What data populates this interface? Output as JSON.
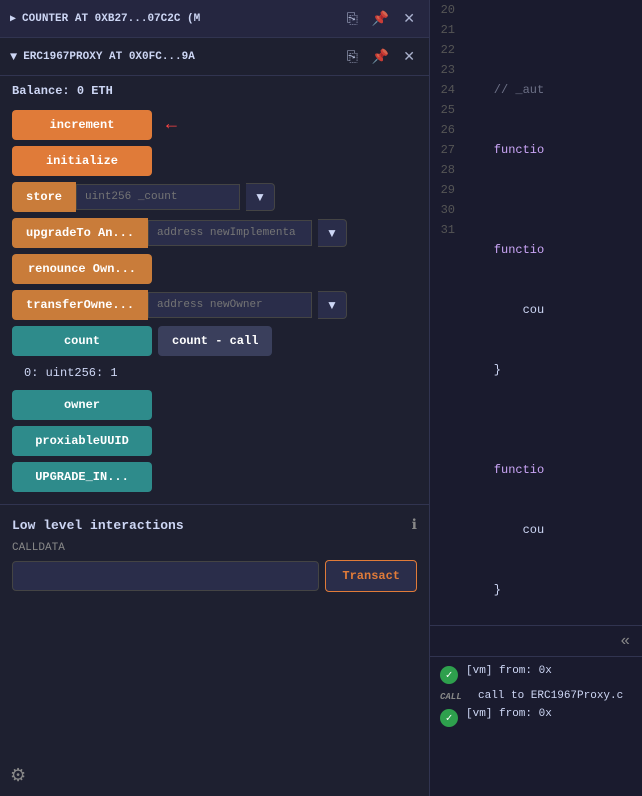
{
  "left_panel": {
    "contract1": {
      "title": "COUNTER AT 0XB27...07C2C (M",
      "copy_label": "copy",
      "pin_label": "pin",
      "close_label": "close"
    },
    "contract2": {
      "title": "ERC1967PROXY AT 0X0FC...9A",
      "copy_label": "copy",
      "pin_label": "pin",
      "close_label": "close"
    },
    "balance": {
      "label": "Balance:",
      "value": "0 ETH"
    },
    "buttons": [
      {
        "id": "increment",
        "label": "increment",
        "type": "orange",
        "has_arrow": true
      },
      {
        "id": "initialize",
        "label": "initialize",
        "type": "orange"
      },
      {
        "id": "store",
        "label": "store",
        "type": "orange-light",
        "input_placeholder": "uint256 _count",
        "has_dropdown": true
      },
      {
        "id": "upgradeToAn",
        "label": "upgradeTo An...",
        "type": "orange-light",
        "input_placeholder": "address newImplementa",
        "has_dropdown": true
      },
      {
        "id": "renounceOwn",
        "label": "renounce Own...",
        "type": "orange-light"
      },
      {
        "id": "transferOwne",
        "label": "transferOwne...",
        "type": "orange-light",
        "input_placeholder": "address newOwner",
        "has_dropdown": true
      },
      {
        "id": "count",
        "label": "count",
        "type": "teal",
        "call_label": "count - call"
      },
      {
        "id": "owner",
        "label": "owner",
        "type": "teal"
      },
      {
        "id": "proxiableUUID",
        "label": "proxiableUUID",
        "type": "teal"
      },
      {
        "id": "UPGRADE_IN",
        "label": "UPGRADE_IN...",
        "type": "teal"
      }
    ],
    "count_result": {
      "label": "0: uint256: 1"
    },
    "low_level": {
      "title": "Low level interactions",
      "calldata_label": "CALLDATA",
      "transact_label": "Transact"
    }
  },
  "right_panel": {
    "line_numbers": [
      20,
      21,
      22,
      23,
      24,
      25,
      26,
      27,
      28,
      29,
      30,
      31
    ],
    "code_lines": [
      "",
      "    // _aut",
      "    functio",
      "",
      "    functio",
      "        cou",
      "    }",
      "",
      "    functio",
      "        cou",
      "    }",
      "}"
    ]
  },
  "terminal": {
    "entries": [
      {
        "type": "success",
        "text": "[vm] from: 0x"
      },
      {
        "type": "call",
        "icon_label": "CALL",
        "text": "call to ERC1967Proxy.c"
      },
      {
        "type": "success",
        "text": "[vm] from: 0x"
      }
    ]
  },
  "icons": {
    "chevron_right": "▶",
    "chevron_down": "▼",
    "copy": "⎘",
    "pin": "📌",
    "close": "✕",
    "info": "ℹ",
    "settings": "⚙",
    "double_chevron": "«"
  }
}
